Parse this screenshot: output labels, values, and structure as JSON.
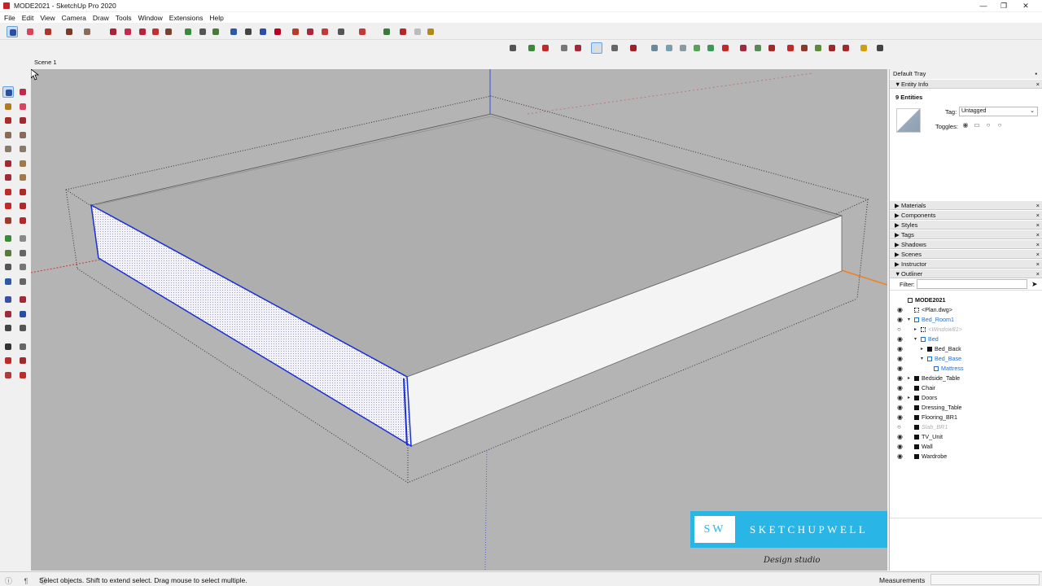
{
  "window": {
    "title": "MODE2021 - SketchUp Pro 2020",
    "minimize": "—",
    "restore": "❐",
    "close": "✕"
  },
  "menu": [
    "File",
    "Edit",
    "View",
    "Camera",
    "Draw",
    "Tools",
    "Window",
    "Extensions",
    "Help"
  ],
  "scene_tab": "Scene 1",
  "tray": {
    "title": "Default Tray",
    "pin": "▪",
    "close": "×",
    "entity_info": {
      "heading": "Entity Info",
      "count": "9 Entities",
      "tag_label": "Tag:",
      "tag_value": "Untagged",
      "toggles_label": "Toggles:"
    },
    "panels": [
      "Materials",
      "Components",
      "Styles",
      "Tags",
      "Shadows",
      "Scenes",
      "Instructor"
    ],
    "outliner": {
      "heading": "Outliner",
      "filter_label": "Filter:",
      "items": [
        {
          "label": "MODE2021",
          "level": 0,
          "eye": "",
          "exp": "",
          "bold": true,
          "color": "#111",
          "icon": "model"
        },
        {
          "label": "<Plan.dwg>",
          "level": 1,
          "eye": "◉",
          "exp": "",
          "color": "#111",
          "icon": "grid"
        },
        {
          "label": "Bed_Room1",
          "level": 1,
          "eye": "◉",
          "exp": "▾",
          "color": "#1d6fd1",
          "icon": "open"
        },
        {
          "label": "<Window81>",
          "level": 2,
          "eye": "○",
          "exp": "▸",
          "color": "#b0b0b0",
          "icon": "grid",
          "italic": true
        },
        {
          "label": "Bed",
          "level": 2,
          "eye": "◉",
          "exp": "▾",
          "color": "#1d6fd1",
          "icon": "open"
        },
        {
          "label": "Bed_Back",
          "level": 3,
          "eye": "◉",
          "exp": "▸",
          "color": "#111",
          "icon": "solid"
        },
        {
          "label": "Bed_Base",
          "level": 3,
          "eye": "◉",
          "exp": "▾",
          "color": "#1d6fd1",
          "icon": "open"
        },
        {
          "label": "Mattress",
          "level": 4,
          "eye": "◉",
          "exp": "",
          "color": "#1d6fd1",
          "icon": "open"
        },
        {
          "label": "Bedside_Table",
          "level": 1,
          "eye": "◉",
          "exp": "▸",
          "color": "#111",
          "icon": "solid"
        },
        {
          "label": "Chair",
          "level": 1,
          "eye": "◉",
          "exp": "",
          "color": "#111",
          "icon": "solid"
        },
        {
          "label": "Doors",
          "level": 1,
          "eye": "◉",
          "exp": "▸",
          "color": "#111",
          "icon": "solid"
        },
        {
          "label": "Dressing_Table",
          "level": 1,
          "eye": "◉",
          "exp": "",
          "color": "#111",
          "icon": "solid"
        },
        {
          "label": "Flooring_BR1",
          "level": 1,
          "eye": "◉",
          "exp": "",
          "color": "#111",
          "icon": "solid"
        },
        {
          "label": "Slab_BR1",
          "level": 1,
          "eye": "○",
          "exp": "",
          "color": "#b0b0b0",
          "icon": "solid",
          "italic": true
        },
        {
          "label": "TV_Unit",
          "level": 1,
          "eye": "◉",
          "exp": "",
          "color": "#111",
          "icon": "solid"
        },
        {
          "label": "Wall",
          "level": 1,
          "eye": "◉",
          "exp": "",
          "color": "#111",
          "icon": "solid"
        },
        {
          "label": "Wardrobe",
          "level": 1,
          "eye": "◉",
          "exp": "",
          "color": "#111",
          "icon": "solid"
        }
      ]
    }
  },
  "watermark": {
    "initials": "SW",
    "brand": "SKETCHUPWELL",
    "tagline": "Design studio"
  },
  "status": {
    "icons": "ⓘ ¶ ◎",
    "hint": "Select objects. Shift to extend select. Drag mouse to select multiple.",
    "measurements_label": "Measurements",
    "measurements_value": ""
  },
  "colors": {
    "accent": "#29b6e6",
    "selection": "#1a2fd6",
    "axis_red": "#c83c3c",
    "axis_green": "#2e9a3a",
    "axis_blue": "#3a4fd6",
    "axis_orange": "#f08020"
  }
}
